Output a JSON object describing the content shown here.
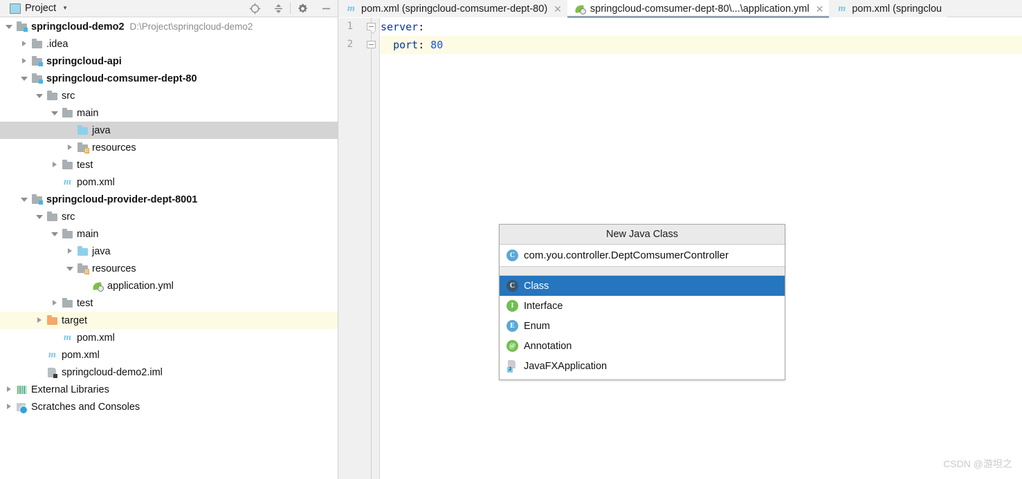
{
  "project_panel": {
    "title": "Project",
    "caret_icon": "chevron-down-icon",
    "panel_icon": "project-view-icon",
    "tools": [
      {
        "name": "locate-icon",
        "label": "Select Opened File"
      },
      {
        "name": "collapse-all-icon",
        "label": "Collapse All"
      },
      {
        "name": "gear-icon",
        "label": "Settings"
      },
      {
        "name": "minimize-icon",
        "label": "Hide"
      }
    ],
    "tree": [
      {
        "label": "springcloud-demo2",
        "path": "D:\\Project\\springcloud-demo2",
        "indent": 0,
        "arrow": "down",
        "icon": "module-folder-icon",
        "bold": true,
        "state": "normal"
      },
      {
        "label": ".idea",
        "path": "",
        "indent": 1,
        "arrow": "right",
        "icon": "folder-icon",
        "bold": false,
        "state": "normal"
      },
      {
        "label": "springcloud-api",
        "path": "",
        "indent": 1,
        "arrow": "right",
        "icon": "module-folder-icon",
        "bold": true,
        "state": "normal"
      },
      {
        "label": "springcloud-comsumer-dept-80",
        "path": "",
        "indent": 1,
        "arrow": "down",
        "icon": "module-folder-icon",
        "bold": true,
        "state": "normal"
      },
      {
        "label": "src",
        "path": "",
        "indent": 2,
        "arrow": "down",
        "icon": "folder-icon",
        "bold": false,
        "state": "normal"
      },
      {
        "label": "main",
        "path": "",
        "indent": 3,
        "arrow": "down",
        "icon": "folder-icon",
        "bold": false,
        "state": "normal"
      },
      {
        "label": "java",
        "path": "",
        "indent": 4,
        "arrow": "none",
        "icon": "source-folder-icon",
        "bold": false,
        "state": "selected"
      },
      {
        "label": "resources",
        "path": "",
        "indent": 4,
        "arrow": "right",
        "icon": "resources-folder-icon",
        "bold": false,
        "state": "normal"
      },
      {
        "label": "test",
        "path": "",
        "indent": 3,
        "arrow": "right",
        "icon": "folder-icon",
        "bold": false,
        "state": "normal"
      },
      {
        "label": "pom.xml",
        "path": "",
        "indent": 3,
        "arrow": "none",
        "icon": "maven-icon",
        "bold": false,
        "state": "normal"
      },
      {
        "label": "springcloud-provider-dept-8001",
        "path": "",
        "indent": 1,
        "arrow": "down",
        "icon": "module-folder-icon",
        "bold": true,
        "state": "normal"
      },
      {
        "label": "src",
        "path": "",
        "indent": 2,
        "arrow": "down",
        "icon": "folder-icon",
        "bold": false,
        "state": "normal"
      },
      {
        "label": "main",
        "path": "",
        "indent": 3,
        "arrow": "down",
        "icon": "folder-icon",
        "bold": false,
        "state": "normal"
      },
      {
        "label": "java",
        "path": "",
        "indent": 4,
        "arrow": "right",
        "icon": "source-folder-icon",
        "bold": false,
        "state": "normal"
      },
      {
        "label": "resources",
        "path": "",
        "indent": 4,
        "arrow": "down",
        "icon": "resources-folder-icon",
        "bold": false,
        "state": "normal"
      },
      {
        "label": "application.yml",
        "path": "",
        "indent": 5,
        "arrow": "none",
        "icon": "yaml-icon",
        "bold": false,
        "state": "normal"
      },
      {
        "label": "test",
        "path": "",
        "indent": 3,
        "arrow": "right",
        "icon": "folder-icon",
        "bold": false,
        "state": "normal"
      },
      {
        "label": "target",
        "path": "",
        "indent": 2,
        "arrow": "right",
        "icon": "excluded-folder-icon",
        "bold": false,
        "state": "excluded"
      },
      {
        "label": "pom.xml",
        "path": "",
        "indent": 3,
        "arrow": "none",
        "icon": "maven-icon",
        "bold": false,
        "state": "normal"
      },
      {
        "label": "pom.xml",
        "path": "",
        "indent": 2,
        "arrow": "none",
        "icon": "maven-icon",
        "bold": false,
        "state": "normal"
      },
      {
        "label": "springcloud-demo2.iml",
        "path": "",
        "indent": 2,
        "arrow": "none",
        "icon": "iml-icon",
        "bold": false,
        "state": "normal"
      },
      {
        "label": "External Libraries",
        "path": "",
        "indent": 0,
        "arrow": "right",
        "icon": "libraries-icon",
        "bold": false,
        "state": "normal"
      },
      {
        "label": "Scratches and Consoles",
        "path": "",
        "indent": 0,
        "arrow": "right",
        "icon": "scratches-icon",
        "bold": false,
        "state": "normal"
      }
    ]
  },
  "editor": {
    "tabs": [
      {
        "label": "pom.xml (springcloud-comsumer-dept-80)",
        "icon": "maven-icon",
        "active": false,
        "closable": true
      },
      {
        "label": "springcloud-comsumer-dept-80\\...\\application.yml",
        "icon": "yaml-icon",
        "active": true,
        "closable": true
      },
      {
        "label": "pom.xml (springclou",
        "icon": "maven-icon",
        "active": false,
        "closable": false
      }
    ],
    "close_icon": "close-icon",
    "lines": [
      {
        "number": "1",
        "indent": "",
        "key": "server",
        "colon": ":",
        "value": "",
        "fold": "open",
        "highlight": false
      },
      {
        "number": "2",
        "indent": "  ",
        "key": "port",
        "colon": ": ",
        "value": "80",
        "fold": "end",
        "highlight": true
      }
    ]
  },
  "new_java_class_dialog": {
    "title": "New Java Class",
    "input_value": "com.you.controller.DeptComsumerController",
    "input_icon": "class-icon",
    "items": [
      {
        "label": "Class",
        "icon": "class-icon",
        "selected": true
      },
      {
        "label": "Interface",
        "icon": "interface-icon",
        "selected": false
      },
      {
        "label": "Enum",
        "icon": "enum-icon",
        "selected": false
      },
      {
        "label": "Annotation",
        "icon": "annotation-icon",
        "selected": false
      },
      {
        "label": "JavaFXApplication",
        "icon": "javafx-icon",
        "selected": false
      }
    ]
  },
  "watermark": {
    "text": "CSDN @游坦之"
  },
  "colors": {
    "selection_blue": "#2675bf",
    "tree_selection_gray": "#d4d4d4",
    "excluded_yellow": "#fdfbe4",
    "toolbar_gray": "#f2f2f2",
    "code_keyword_blue": "#0033b3",
    "code_number_blue": "#1750eb"
  }
}
